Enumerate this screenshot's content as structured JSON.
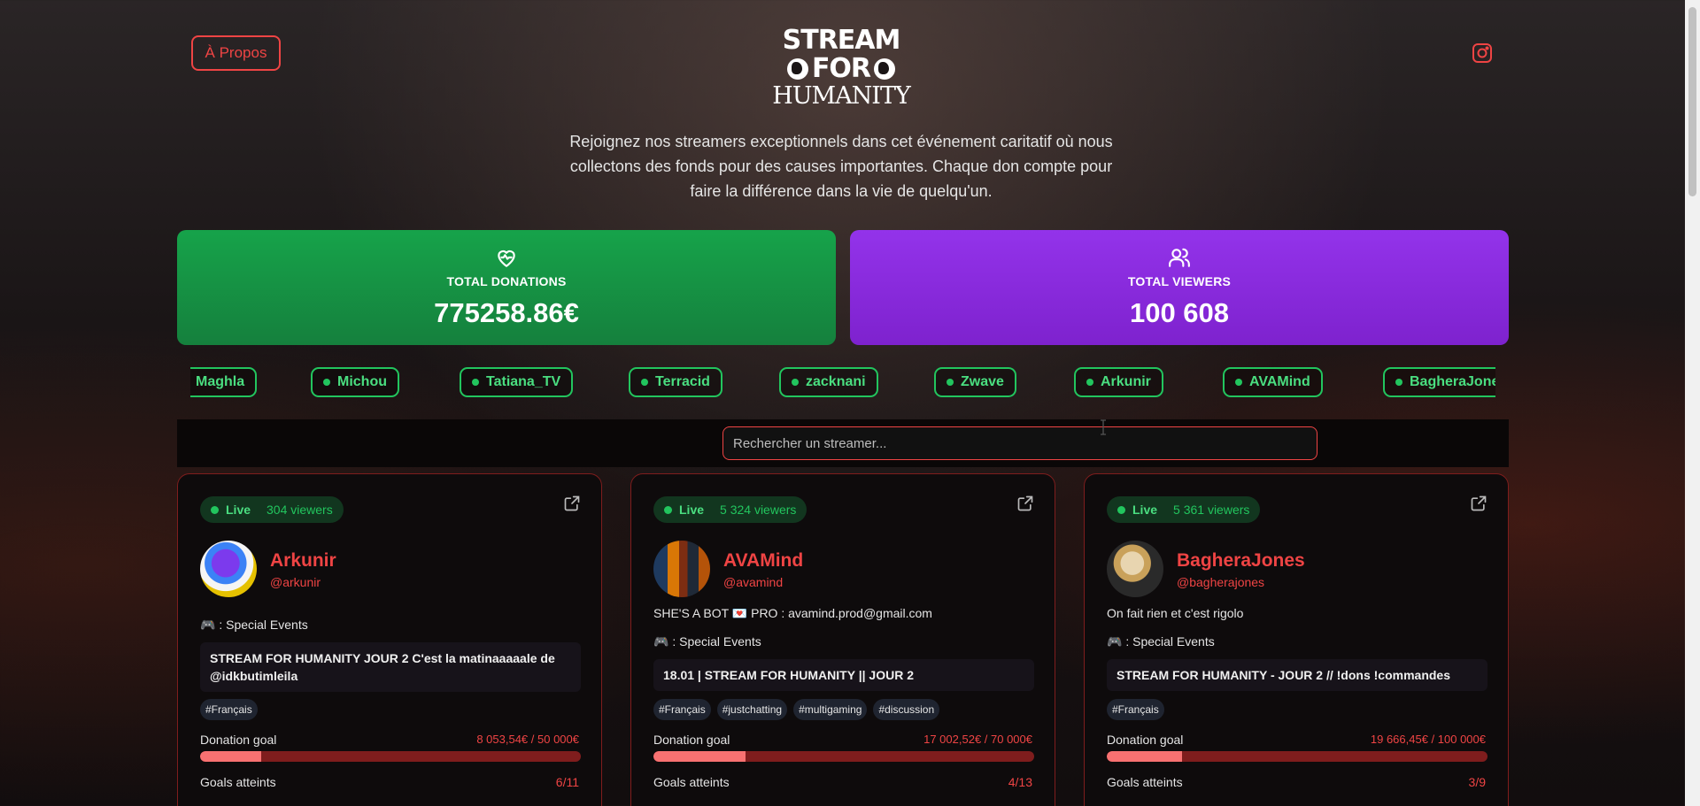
{
  "header": {
    "about_label": "À Propos",
    "instagram_icon": "instagram-icon",
    "logo": {
      "line1": "STREAM",
      "line2": "FOR",
      "line3": "HUMANITY"
    },
    "intro": "Rejoignez nos streamers exceptionnels dans cet événement caritatif où nous collectons des fonds pour des causes importantes. Chaque don compte pour faire la différence dans la vie de quelqu'un."
  },
  "stats": {
    "donations": {
      "label": "TOTAL DONATIONS",
      "value": "775258.86€",
      "icon": "heart-pulse-icon",
      "color": "#16a34a"
    },
    "viewers": {
      "label": "TOTAL VIEWERS",
      "value": "100 608",
      "icon": "users-icon",
      "color": "#9333ea"
    }
  },
  "ticker": [
    "Maghla",
    "Michou",
    "Tatiana_TV",
    "Terracid",
    "zacknani",
    "Zwave",
    "Arkunir",
    "AVAMind",
    "BagheraJones"
  ],
  "search": {
    "placeholder": "Rechercher un streamer..."
  },
  "cards": [
    {
      "status": "Live",
      "viewers": "304 viewers",
      "name": "Arkunir",
      "handle": "@arkunir",
      "bio": "",
      "category": "🎮 : Special Events",
      "title": "STREAM FOR HUMANITY JOUR 2 C'est la matinaaaaale de @idkbutimleila",
      "tags": [
        "#Français"
      ],
      "goal_label": "Donation goal",
      "goal_value": "8 053,54€ / 50 000€",
      "goal_progress": 0.161,
      "goals_label": "Goals atteints",
      "goals_value": "6/11"
    },
    {
      "status": "Live",
      "viewers": "5 324 viewers",
      "name": "AVAMind",
      "handle": "@avamind",
      "bio": "SHE'S A BOT 💌 PRO : avamind.prod@gmail.com",
      "category": "🎮 : Special Events",
      "title": "18.01 | STREAM FOR HUMANITY || JOUR 2",
      "tags": [
        "#Français",
        "#justchatting",
        "#multigaming",
        "#discussion"
      ],
      "goal_label": "Donation goal",
      "goal_value": "17 002,52€ / 70 000€",
      "goal_progress": 0.243,
      "goals_label": "Goals atteints",
      "goals_value": "4/13"
    },
    {
      "status": "Live",
      "viewers": "5 361 viewers",
      "name": "BagheraJones",
      "handle": "@bagherajones",
      "bio": "On fait rien et c'est rigolo",
      "category": "🎮 : Special Events",
      "title": "STREAM FOR HUMANITY - JOUR 2 // !dons !commandes",
      "tags": [
        "#Français"
      ],
      "goal_label": "Donation goal",
      "goal_value": "19 666,45€ / 100 000€",
      "goal_progress": 0.197,
      "goals_label": "Goals atteints",
      "goals_value": "3/9"
    }
  ]
}
